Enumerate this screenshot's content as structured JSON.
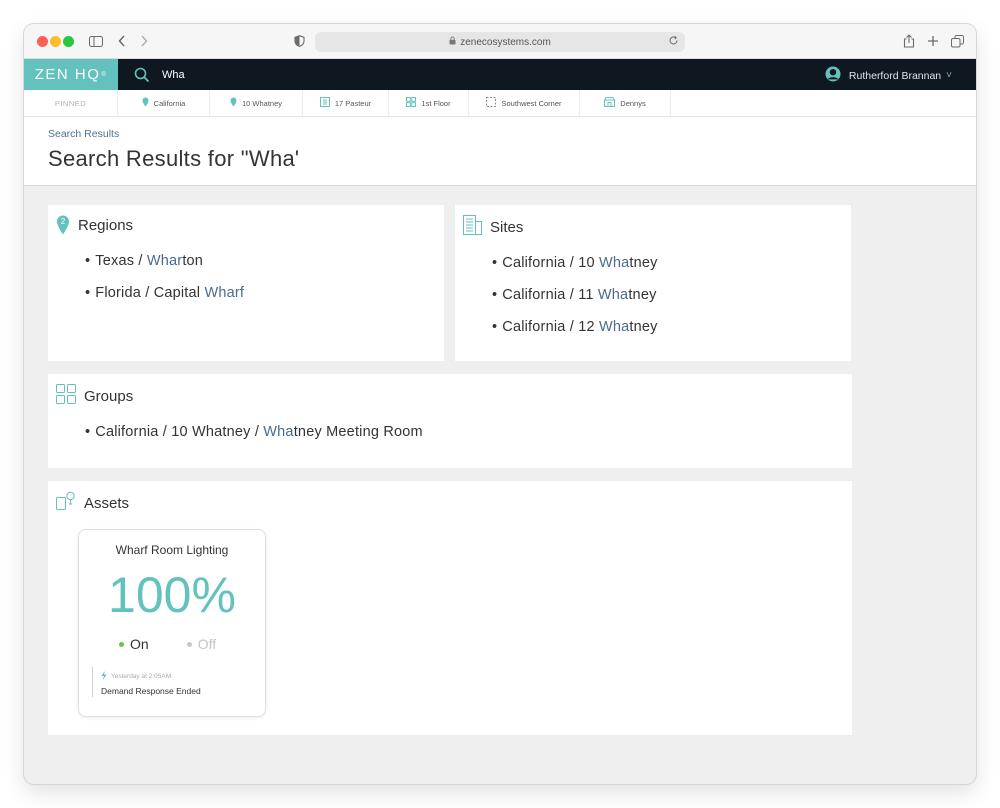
{
  "browser": {
    "url": "zenecosystems.com"
  },
  "header": {
    "logo": "ZEN HQ",
    "logo_mark": "®",
    "search_value": "Wha",
    "user_name": "Rutherford Brannan",
    "chevron": "˅"
  },
  "pinned": {
    "label": "PINNED",
    "items": [
      {
        "label": "California",
        "icon": "map-pin-icon"
      },
      {
        "label": "10 Whatney",
        "icon": "map-pin-icon"
      },
      {
        "label": "17 Pasteur",
        "icon": "building-icon"
      },
      {
        "label": "1st Floor",
        "icon": "grid-icon"
      },
      {
        "label": "Southwest Corner",
        "icon": "dashed-square-icon"
      },
      {
        "label": "Dennys",
        "icon": "store-icon"
      }
    ]
  },
  "page": {
    "breadcrumb": "Search Results",
    "title": "Search Results for \"Wha\""
  },
  "regions": {
    "title": "Regions",
    "badge": "2",
    "items": [
      {
        "prefix": "Texas / ",
        "match": "Whar",
        "suffix": "ton"
      },
      {
        "prefix": "Florida / Capital ",
        "match": "Wharf",
        "suffix": ""
      }
    ]
  },
  "sites": {
    "title": "Sites",
    "items": [
      {
        "prefix": "California / 10 ",
        "match": "Wha",
        "suffix": "tney"
      },
      {
        "prefix": "California / 11 ",
        "match": "Wha",
        "suffix": "tney"
      },
      {
        "prefix": "California / 12 ",
        "match": "Wha",
        "suffix": "tney"
      }
    ]
  },
  "groups": {
    "title": "Groups",
    "items": [
      {
        "prefix": "California / 10 Whatney / ",
        "match": "Wha",
        "suffix": "tney Meeting Room"
      }
    ]
  },
  "assets": {
    "title": "Assets",
    "tile": {
      "name": "Wharf Room Lighting",
      "value": "100%",
      "on_label": "On",
      "off_label": "Off",
      "event_time": "Yesterday at 2:05AM",
      "event_text": "Demand Response Ended"
    }
  },
  "colors": {
    "accent": "#63c2bd",
    "header_bg": "#0f1820",
    "highlight": "#4a6b8a",
    "on_dot": "#6cc24a",
    "off_dot": "#c8c8c8"
  }
}
